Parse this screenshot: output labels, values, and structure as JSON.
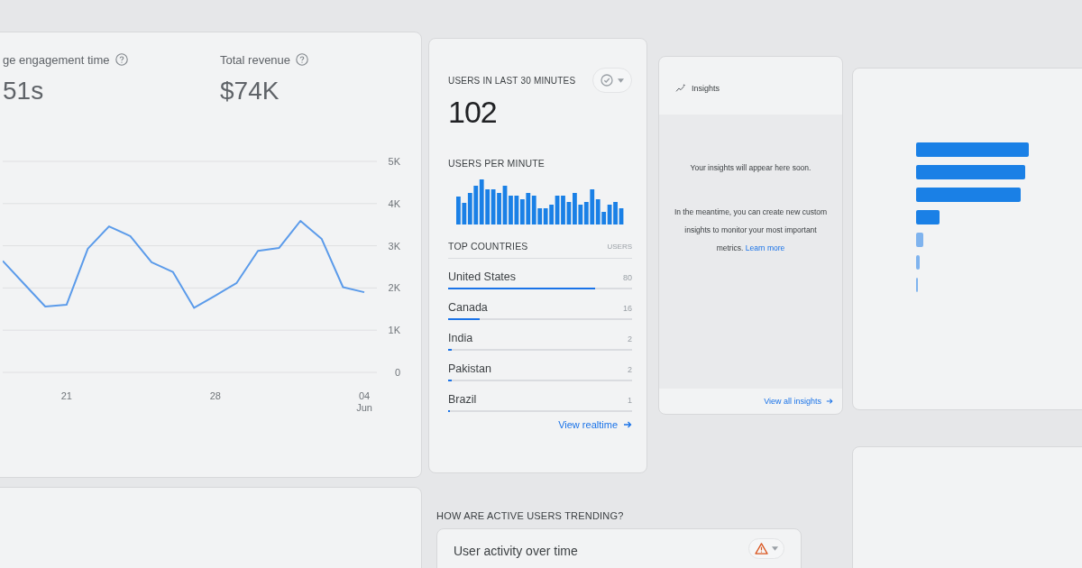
{
  "overview_card": {
    "metrics": [
      {
        "label": "ge engagement time",
        "value": "51s"
      },
      {
        "label": "Total revenue",
        "value": "$74K"
      }
    ],
    "chart_data": {
      "type": "line",
      "categories": [
        null,
        null,
        null,
        "21",
        null,
        null,
        null,
        null,
        null,
        null,
        "28",
        null,
        null,
        null,
        null,
        null,
        null,
        "04 Jun"
      ],
      "series": [
        {
          "color": "#5b9bea",
          "values": [
            2640,
            2100,
            1560,
            1600,
            2930,
            3460,
            3230,
            2610,
            2380,
            1530,
            1820,
            2120,
            2880,
            2950,
            3590,
            3160,
            2020,
            1900
          ]
        }
      ],
      "ylim": [
        0,
        5000
      ],
      "yticks": [
        {
          "value": 0,
          "label": "0"
        },
        {
          "value": 1000,
          "label": "1K"
        },
        {
          "value": 2000,
          "label": "2K"
        },
        {
          "value": 3000,
          "label": "3K"
        },
        {
          "value": 4000,
          "label": "4K"
        },
        {
          "value": 5000,
          "label": "5K"
        }
      ],
      "grid": true
    }
  },
  "realtime_card": {
    "title": "USERS IN LAST 30 MINUTES",
    "count": "102",
    "per_minute_label": "USERS PER MINUTE",
    "countries_heading": "TOP COUNTRIES",
    "users_heading": "USERS",
    "countries": [
      {
        "name": "United States",
        "users": "80",
        "level": 0.8
      },
      {
        "name": "Canada",
        "users": "16",
        "level": 0.17
      },
      {
        "name": "India",
        "users": "2",
        "level": 0.02
      },
      {
        "name": "Pakistan",
        "users": "2",
        "level": 0.02
      },
      {
        "name": "Brazil",
        "users": "1",
        "level": 0.01
      }
    ],
    "link": "View realtime"
  },
  "insights_card": {
    "title": "Insights",
    "message": "Your insights will appear here soon.",
    "body": "In the meantime, you can create new custom insights to monitor your most important metrics.",
    "learn_more": "Learn more",
    "link": "View all insights"
  },
  "trend_section": {
    "heading": "HOW ARE ACTIVE USERS TRENDING?",
    "card_title": "User activity over time"
  }
}
